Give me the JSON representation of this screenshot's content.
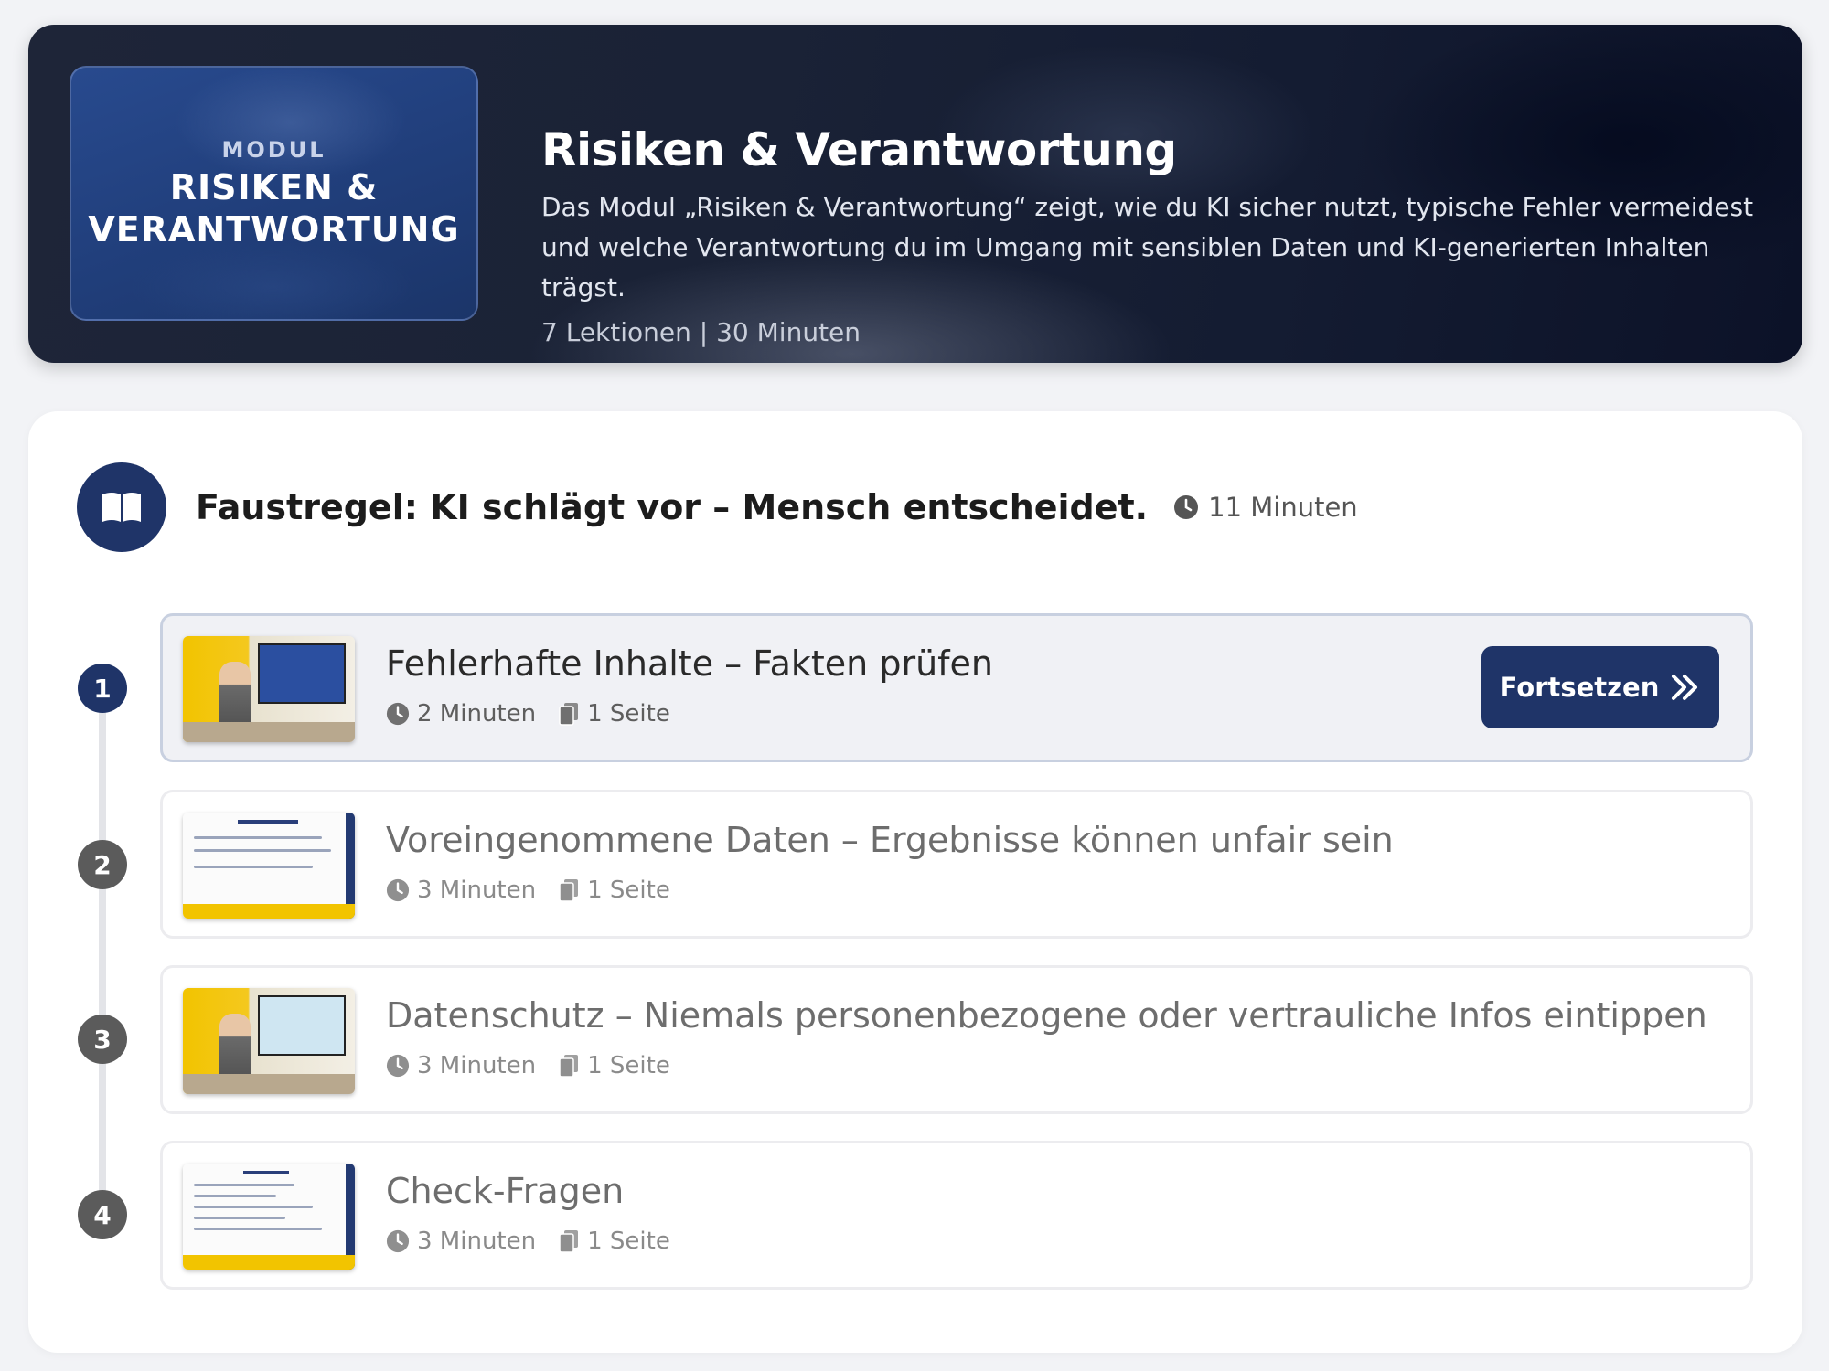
{
  "module": {
    "thumb_kicker": "MODUL",
    "thumb_title_line1": "RISIKEN &",
    "thumb_title_line2": "VERANTWORTUNG",
    "title": "Risiken & Verantwortung",
    "description": "Das Modul „Risiken & Verantwortung“ zeigt, wie du KI sicher nutzt, typische Fehler vermeidest und welche Verantwortung du im Umgang mit sensiblen Daten und KI-generierten Inhalten trägst.",
    "meta": "7 Lektionen | 30 Minuten"
  },
  "section": {
    "icon": "book-open-icon",
    "title": "Faustregel: KI schlägt vor – Mensch entscheidet.",
    "duration": "11 Minuten"
  },
  "lessons": [
    {
      "number": "1",
      "title": "Fehlerhafte Inhalte – Fakten prüfen",
      "duration": "2 Minuten",
      "pages": "1 Seite",
      "active": true,
      "button_label": "Fortsetzen"
    },
    {
      "number": "2",
      "title": "Voreingenommene Daten – Ergebnisse können unfair sein",
      "duration": "3 Minuten",
      "pages": "1 Seite",
      "active": false
    },
    {
      "number": "3",
      "title": "Datenschutz – Niemals personenbezogene oder vertrauliche Infos eintippen",
      "duration": "3 Minuten",
      "pages": "1 Seite",
      "active": false
    },
    {
      "number": "4",
      "title": "Check-Fragen",
      "duration": "3 Minuten",
      "pages": "1 Seite",
      "active": false
    }
  ],
  "colors": {
    "primary": "#1f3468",
    "inactive_step": "#5b5b5b",
    "accent_yellow": "#f2c400"
  }
}
